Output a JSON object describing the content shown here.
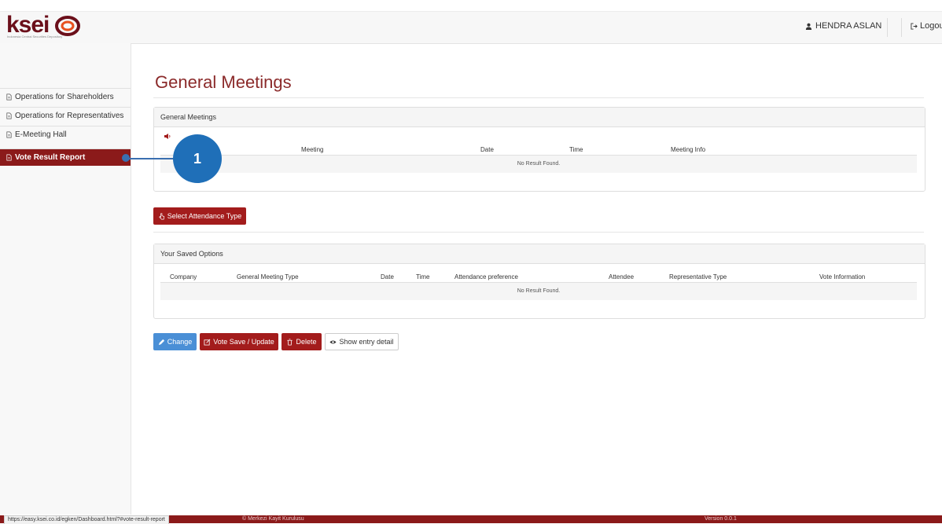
{
  "header": {
    "logo": "ksei",
    "logo_sub": "Indonesia Central Securities Depository",
    "user_name": "HENDRA ASLAN",
    "logout_label": "Logout"
  },
  "sidebar": {
    "items": [
      {
        "label": "Operations for Shareholders"
      },
      {
        "label": "Operations for Representatives"
      },
      {
        "label": "E-Meeting Hall"
      },
      {
        "label": "Vote Result Report"
      }
    ]
  },
  "main": {
    "title": "General Meetings",
    "meetings_panel": {
      "heading": "General Meetings",
      "columns": [
        "Meeting",
        "Date",
        "Time",
        "Meeting Info"
      ],
      "empty_text": "No Result Found."
    },
    "select_button": "Select Attendance Type",
    "saved_panel": {
      "heading": "Your Saved Options",
      "columns": [
        "Company",
        "General Meeting Type",
        "Date",
        "Time",
        "Attendance preference",
        "Attendee",
        "Representative Type",
        "Vote Information"
      ],
      "empty_text": "No Result Found."
    },
    "actions": {
      "change": "Change",
      "vote_save": "Vote Save / Update",
      "delete": "Delete",
      "show_detail": "Show entry detail"
    }
  },
  "callout": {
    "number": "1"
  },
  "footer": {
    "url": "https://easy.ksei.co.id/egken/Dashboard.html?#vote-result-report",
    "copyright": "© Merkezi Kayit Kurulusu",
    "version": "Version 0.0.1"
  },
  "colors": {
    "brand": "#8b1a1a",
    "title": "#8b2a2a",
    "accent_blue": "#4a8fd6",
    "callout": "#1f6fb8"
  }
}
